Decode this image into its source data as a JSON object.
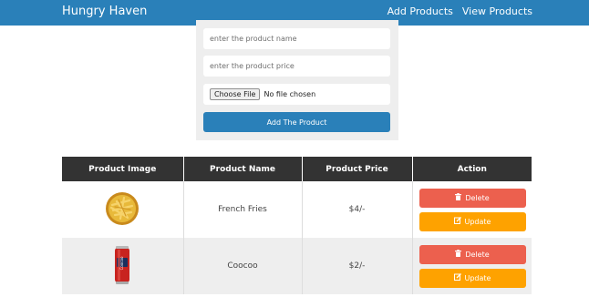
{
  "nav": {
    "brand": "Hungry Haven",
    "links": [
      "Add Products",
      "View Products"
    ]
  },
  "form": {
    "name_placeholder": "enter the product name",
    "price_placeholder": "enter the product price",
    "file_button": "Choose File",
    "file_status": "No file chosen",
    "submit_label": "Add The Product"
  },
  "table": {
    "headers": [
      "Product Image",
      "Product Name",
      "Product Price",
      "Action"
    ],
    "rows": [
      {
        "name": "French Fries",
        "price": "$4/-",
        "image_icon": "french-fries-bowl"
      },
      {
        "name": "Coocoo",
        "price": "$2/-",
        "image_icon": "soda-can"
      }
    ],
    "delete_label": "Delete",
    "update_label": "Update"
  },
  "colors": {
    "primary": "#2a80b9",
    "header_bg": "#333333",
    "delete": "#ec604e",
    "update": "#fea200"
  }
}
